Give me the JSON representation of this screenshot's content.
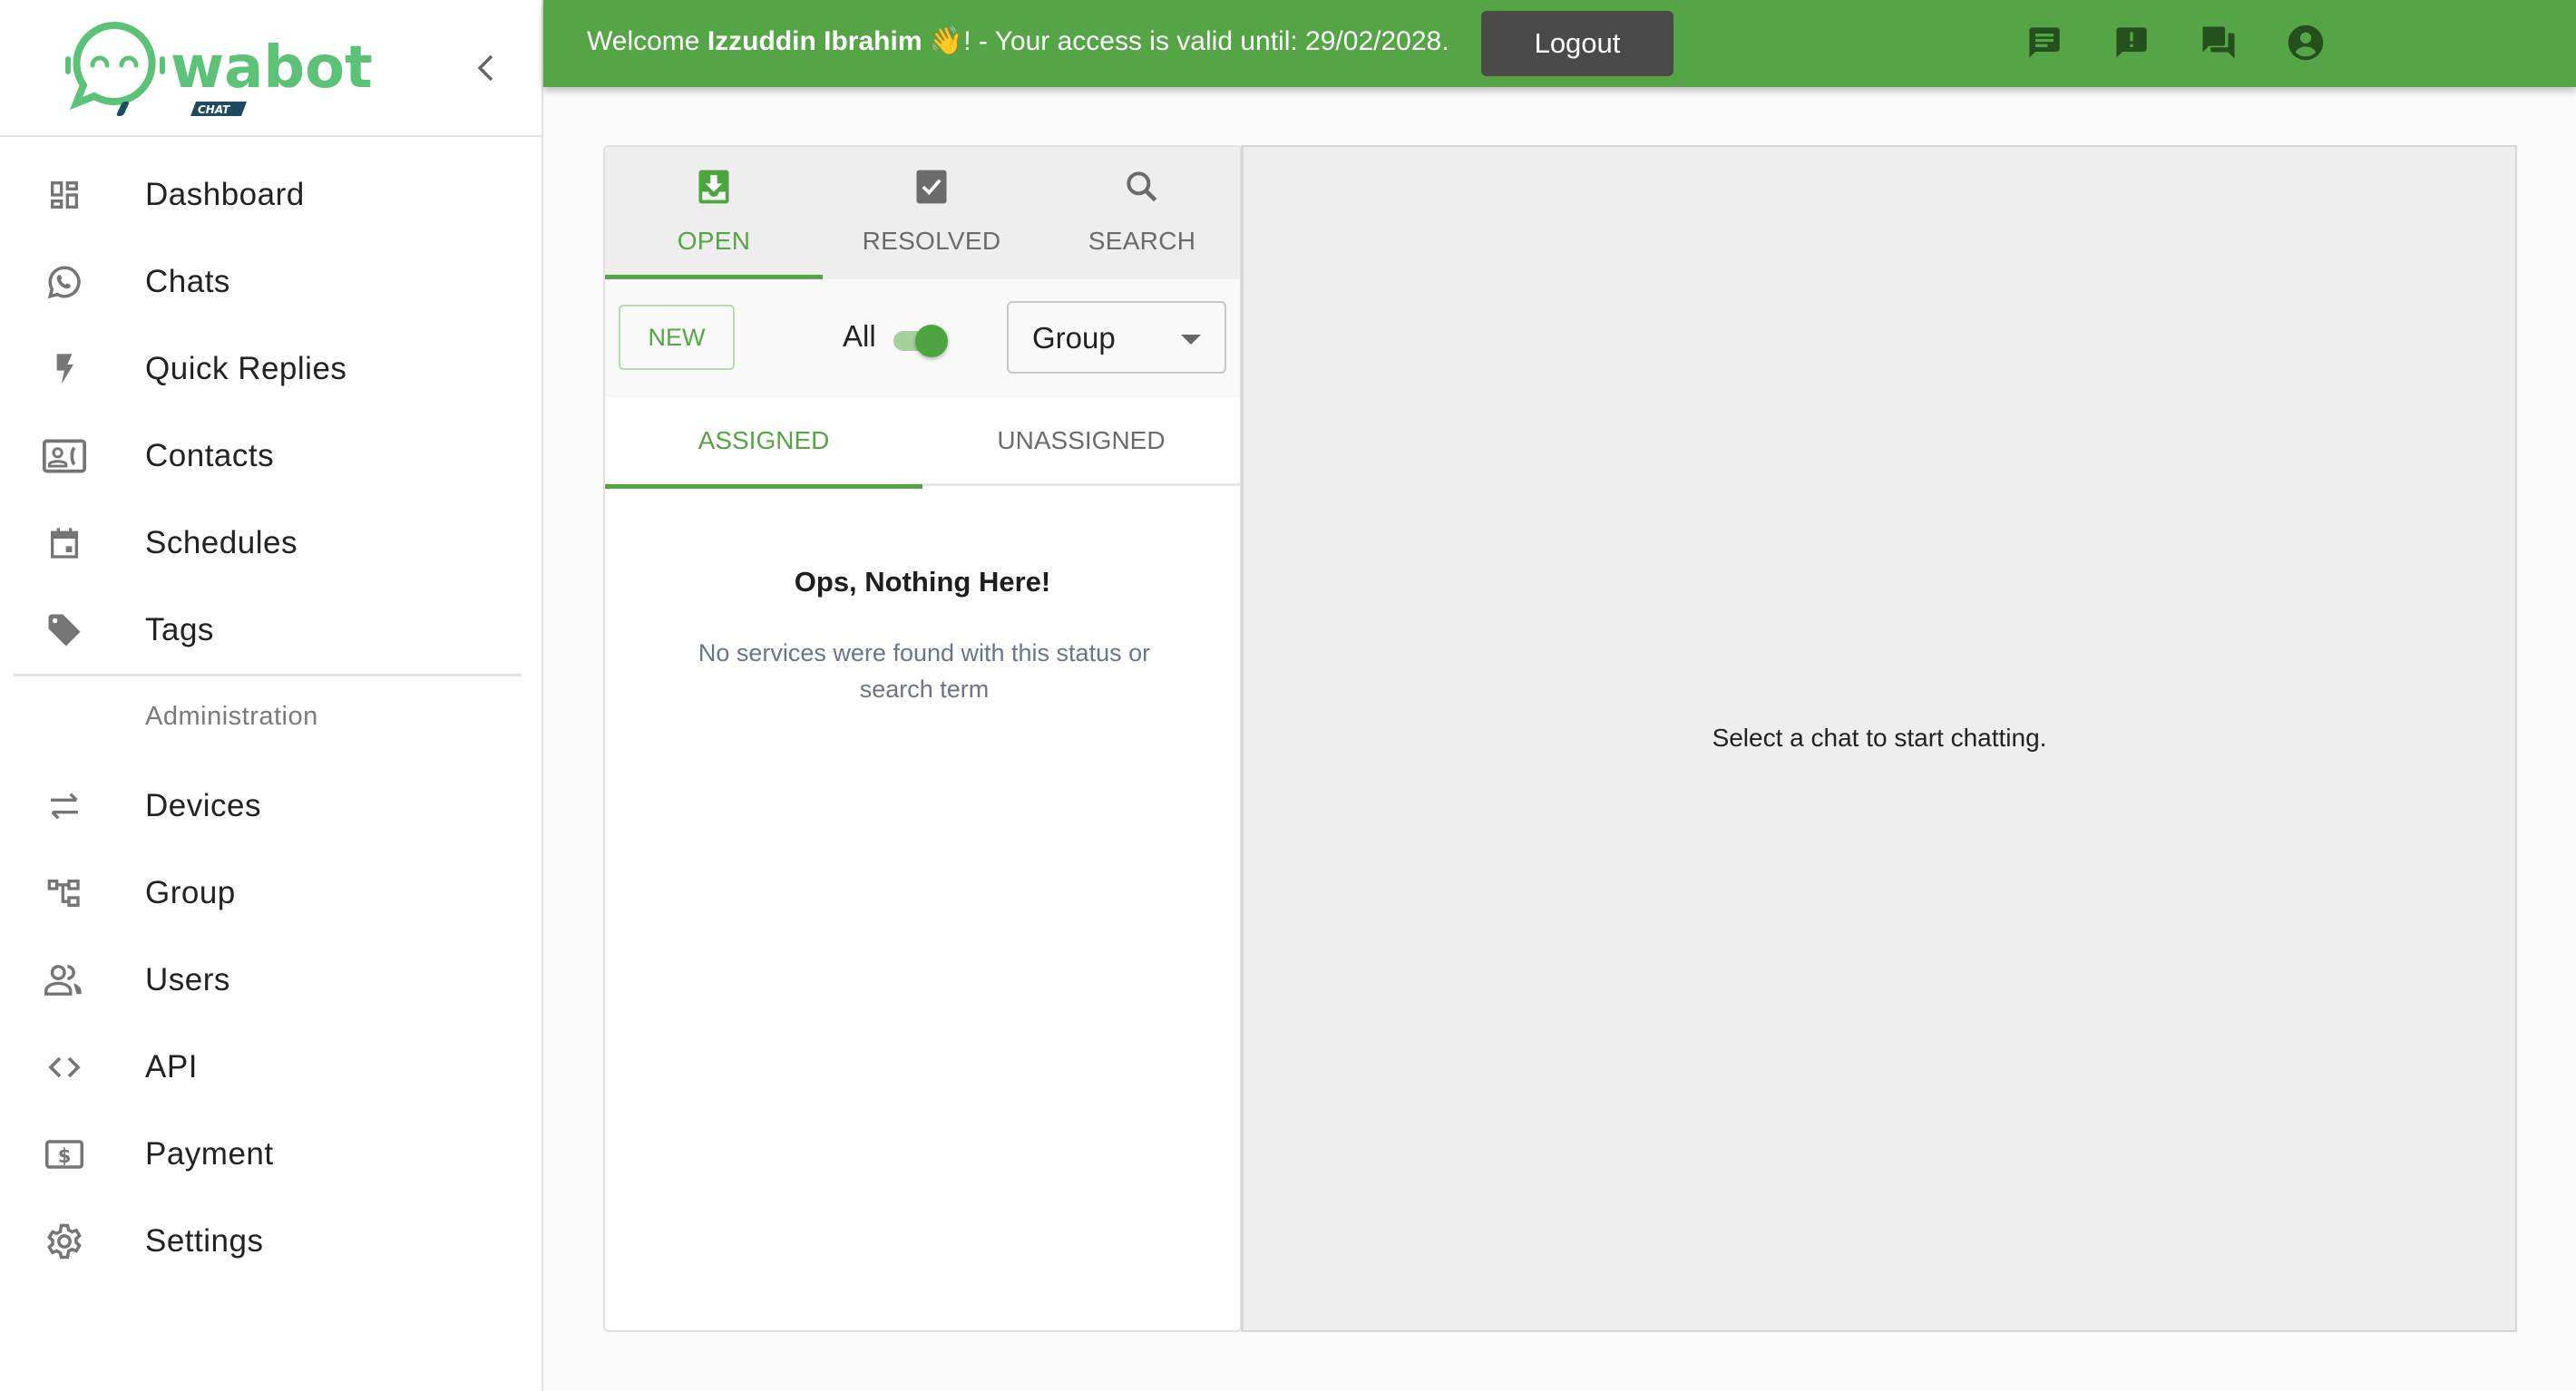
{
  "brand": {
    "name": "wabot",
    "sub": "CHAT",
    "colors": {
      "primary": "#55a546",
      "logo_green": "#5cc277",
      "logo_navy": "#1e4a63"
    }
  },
  "sidebar": {
    "collapse_icon": "chevron-left-icon",
    "items": [
      {
        "label": "Dashboard",
        "icon": "dashboard-icon"
      },
      {
        "label": "Chats",
        "icon": "whatsapp-icon"
      },
      {
        "label": "Quick Replies",
        "icon": "flash-icon"
      },
      {
        "label": "Contacts",
        "icon": "contact-card-icon"
      },
      {
        "label": "Schedules",
        "icon": "calendar-icon"
      },
      {
        "label": "Tags",
        "icon": "tag-icon"
      }
    ],
    "section_title": "Administration",
    "admin_items": [
      {
        "label": "Devices",
        "icon": "swap-arrows-icon"
      },
      {
        "label": "Group",
        "icon": "hierarchy-icon"
      },
      {
        "label": "Users",
        "icon": "users-icon"
      },
      {
        "label": "API",
        "icon": "code-icon"
      },
      {
        "label": "Payment",
        "icon": "dollar-icon"
      },
      {
        "label": "Settings",
        "icon": "gear-icon"
      }
    ]
  },
  "header": {
    "welcome_prefix": "Welcome ",
    "user_name": "Izzuddin Ibrahim",
    "wave_emoji": "👋",
    "welcome_suffix": "! - Your access is valid until: 29/02/2028.",
    "icons": [
      "message-icon",
      "feedback-icon",
      "forum-icon",
      "account-circle-icon"
    ],
    "logout_label": "Logout"
  },
  "tickets": {
    "tabs": [
      {
        "label": "OPEN",
        "icon": "inbox-download-icon",
        "active": true
      },
      {
        "label": "RESOLVED",
        "icon": "checkbox-icon",
        "active": false
      },
      {
        "label": "SEARCH",
        "icon": "search-icon",
        "active": false
      }
    ],
    "new_label": "NEW",
    "all_label": "All",
    "all_toggle_on": true,
    "group_select_value": "Group",
    "subtabs": [
      {
        "label": "ASSIGNED",
        "active": true
      },
      {
        "label": "UNASSIGNED",
        "active": false
      }
    ],
    "empty_title": "Ops, Nothing Here!",
    "empty_desc": "No services were found with this status or search term"
  },
  "chat": {
    "placeholder": "Select a chat to start chatting."
  }
}
